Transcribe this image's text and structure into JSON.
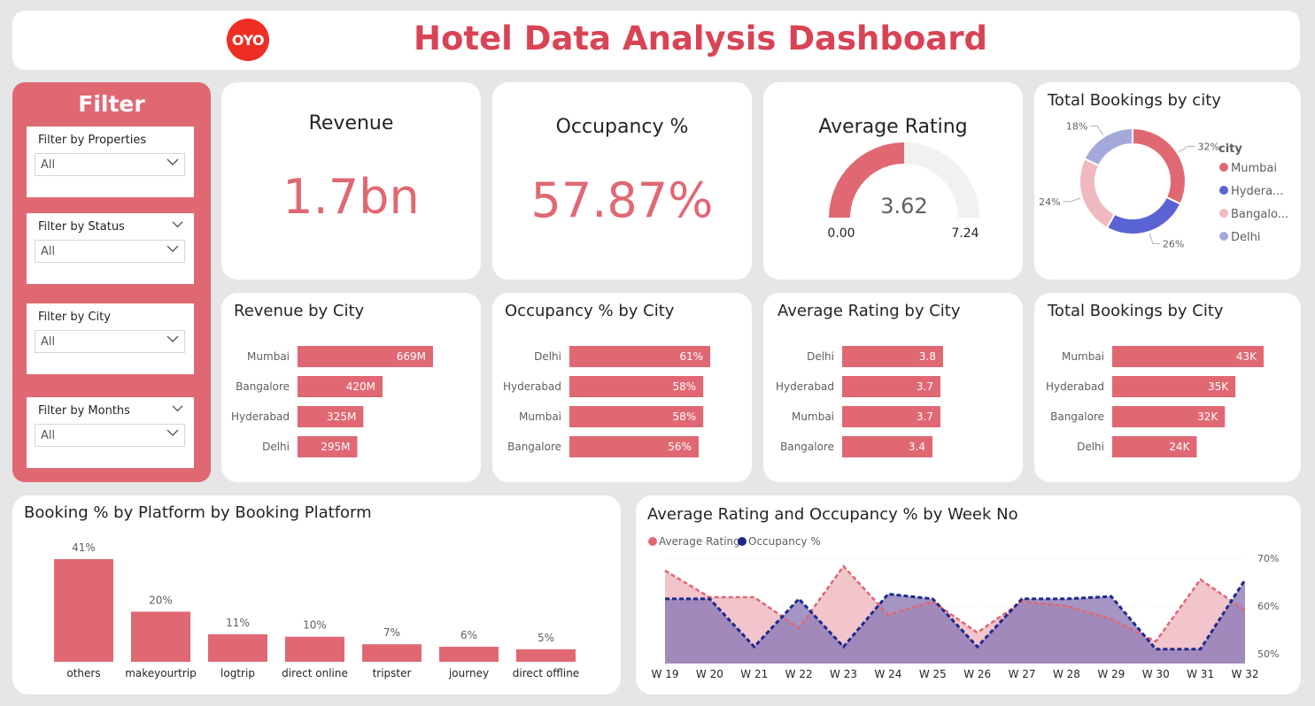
{
  "header": {
    "logo_text": "OYO",
    "title": "Hotel Data Analysis Dashboard"
  },
  "filters": {
    "title": "Filter",
    "items": [
      {
        "label": "Filter by Properties",
        "value": "All",
        "has_chevron": false
      },
      {
        "label": "Filter by Status",
        "value": "All",
        "has_chevron": true
      },
      {
        "label": "Filter by City",
        "value": "All",
        "has_chevron": false
      },
      {
        "label": "Filter by Months",
        "value": "All",
        "has_chevron": true
      }
    ]
  },
  "kpis": {
    "revenue": {
      "label": "Revenue",
      "value": "1.7bn"
    },
    "occupancy": {
      "label": "Occupancy %",
      "value": "57.87%"
    },
    "rating": {
      "label": "Average Rating",
      "value": 3.62,
      "value_label": "3.62",
      "min_label": "0.00",
      "max_label": "7.24",
      "min": 0,
      "max": 7.24
    }
  },
  "colors": {
    "accent": "#e06873",
    "title": "#d84455",
    "navy": "#1c2a8c",
    "purple": "#8d7bb7",
    "pink_fill": "#f0c2c8"
  },
  "chart_data": [
    {
      "id": "bookings-donut",
      "type": "pie",
      "title": "Total Bookings by city",
      "legend_title": "city",
      "legend_placement": "right",
      "categories": [
        "Mumbai",
        "Hydera...",
        "Bangalo...",
        "Delhi"
      ],
      "values": [
        32,
        26,
        24,
        18
      ],
      "labels": [
        "32%",
        "26%",
        "24%",
        "18%"
      ],
      "colors": [
        "#e06873",
        "#5a63d4",
        "#f0b8c0",
        "#a5a8db"
      ]
    },
    {
      "id": "revenue-by-city",
      "type": "bar",
      "title": "Revenue by City",
      "categories": [
        "Mumbai",
        "Bangalore",
        "Hyderabad",
        "Delhi"
      ],
      "values": [
        669,
        420,
        325,
        295
      ],
      "labels": [
        "669M",
        "420M",
        "325M",
        "295M"
      ],
      "xlim": [
        0,
        669
      ]
    },
    {
      "id": "occupancy-by-city",
      "type": "bar",
      "title": "Occupancy % by City",
      "categories": [
        "Delhi",
        "Hyderabad",
        "Mumbai",
        "Bangalore"
      ],
      "values": [
        61,
        58,
        58,
        56
      ],
      "labels": [
        "61%",
        "58%",
        "58%",
        "56%"
      ],
      "xlim": [
        0,
        61
      ]
    },
    {
      "id": "rating-by-city",
      "type": "bar",
      "title": "Average Rating by City",
      "categories": [
        "Delhi",
        "Hyderabad",
        "Mumbai",
        "Bangalore"
      ],
      "values": [
        3.8,
        3.7,
        3.7,
        3.4
      ],
      "labels": [
        "3.8",
        "3.7",
        "3.7",
        "3.4"
      ],
      "xlim": [
        0,
        3.8
      ]
    },
    {
      "id": "bookings-by-city",
      "type": "bar",
      "title": "Total Bookings by City",
      "categories": [
        "Mumbai",
        "Hyderabad",
        "Bangalore",
        "Delhi"
      ],
      "values": [
        43,
        35,
        32,
        24
      ],
      "labels": [
        "43K",
        "35K",
        "32K",
        "24K"
      ],
      "xlim": [
        0,
        43
      ]
    },
    {
      "id": "booking-platform",
      "type": "bar",
      "title": "Booking % by Platform by Booking Platform",
      "categories": [
        "others",
        "makeyourtrip",
        "logtrip",
        "direct online",
        "tripster",
        "journey",
        "direct offline"
      ],
      "values": [
        41,
        20,
        11,
        10,
        7,
        6,
        5
      ],
      "labels": [
        "41%",
        "20%",
        "11%",
        "10%",
        "7%",
        "6%",
        "5%"
      ],
      "ylim": [
        0,
        41
      ]
    },
    {
      "id": "rating-occupancy-week",
      "type": "area",
      "title": "Average Rating and Occupancy % by Week No",
      "legend_placement": "top-left",
      "categories": [
        "W 19",
        "W 20",
        "W 21",
        "W 22",
        "W 23",
        "W 24",
        "W 25",
        "W 26",
        "W 27",
        "W 28",
        "W 29",
        "W 30",
        "W 31",
        "W 32"
      ],
      "series": [
        {
          "name": "Average Rating",
          "color": "#e06873",
          "fill": "#f0c2c8",
          "values": [
            3.75,
            3.45,
            3.45,
            3.1,
            3.8,
            3.25,
            3.4,
            3.05,
            3.4,
            3.35,
            3.2,
            2.95,
            3.65,
            3.3
          ]
        },
        {
          "name": "Occupancy %",
          "color": "#1c2a8c",
          "fill": "#8d7bb7",
          "values": [
            61.5,
            61.5,
            51.5,
            61.5,
            51.5,
            62.5,
            61.5,
            51.5,
            61.5,
            61.5,
            62.0,
            51.0,
            51.0,
            65.5
          ]
        }
      ],
      "y_right": {
        "ticks": [
          50,
          60,
          70
        ],
        "tick_labels": [
          "50%",
          "60%",
          "70%"
        ],
        "ylim": [
          48,
          72
        ]
      },
      "y_left": {
        "ylim": [
          2.7,
          4.0
        ]
      }
    }
  ]
}
